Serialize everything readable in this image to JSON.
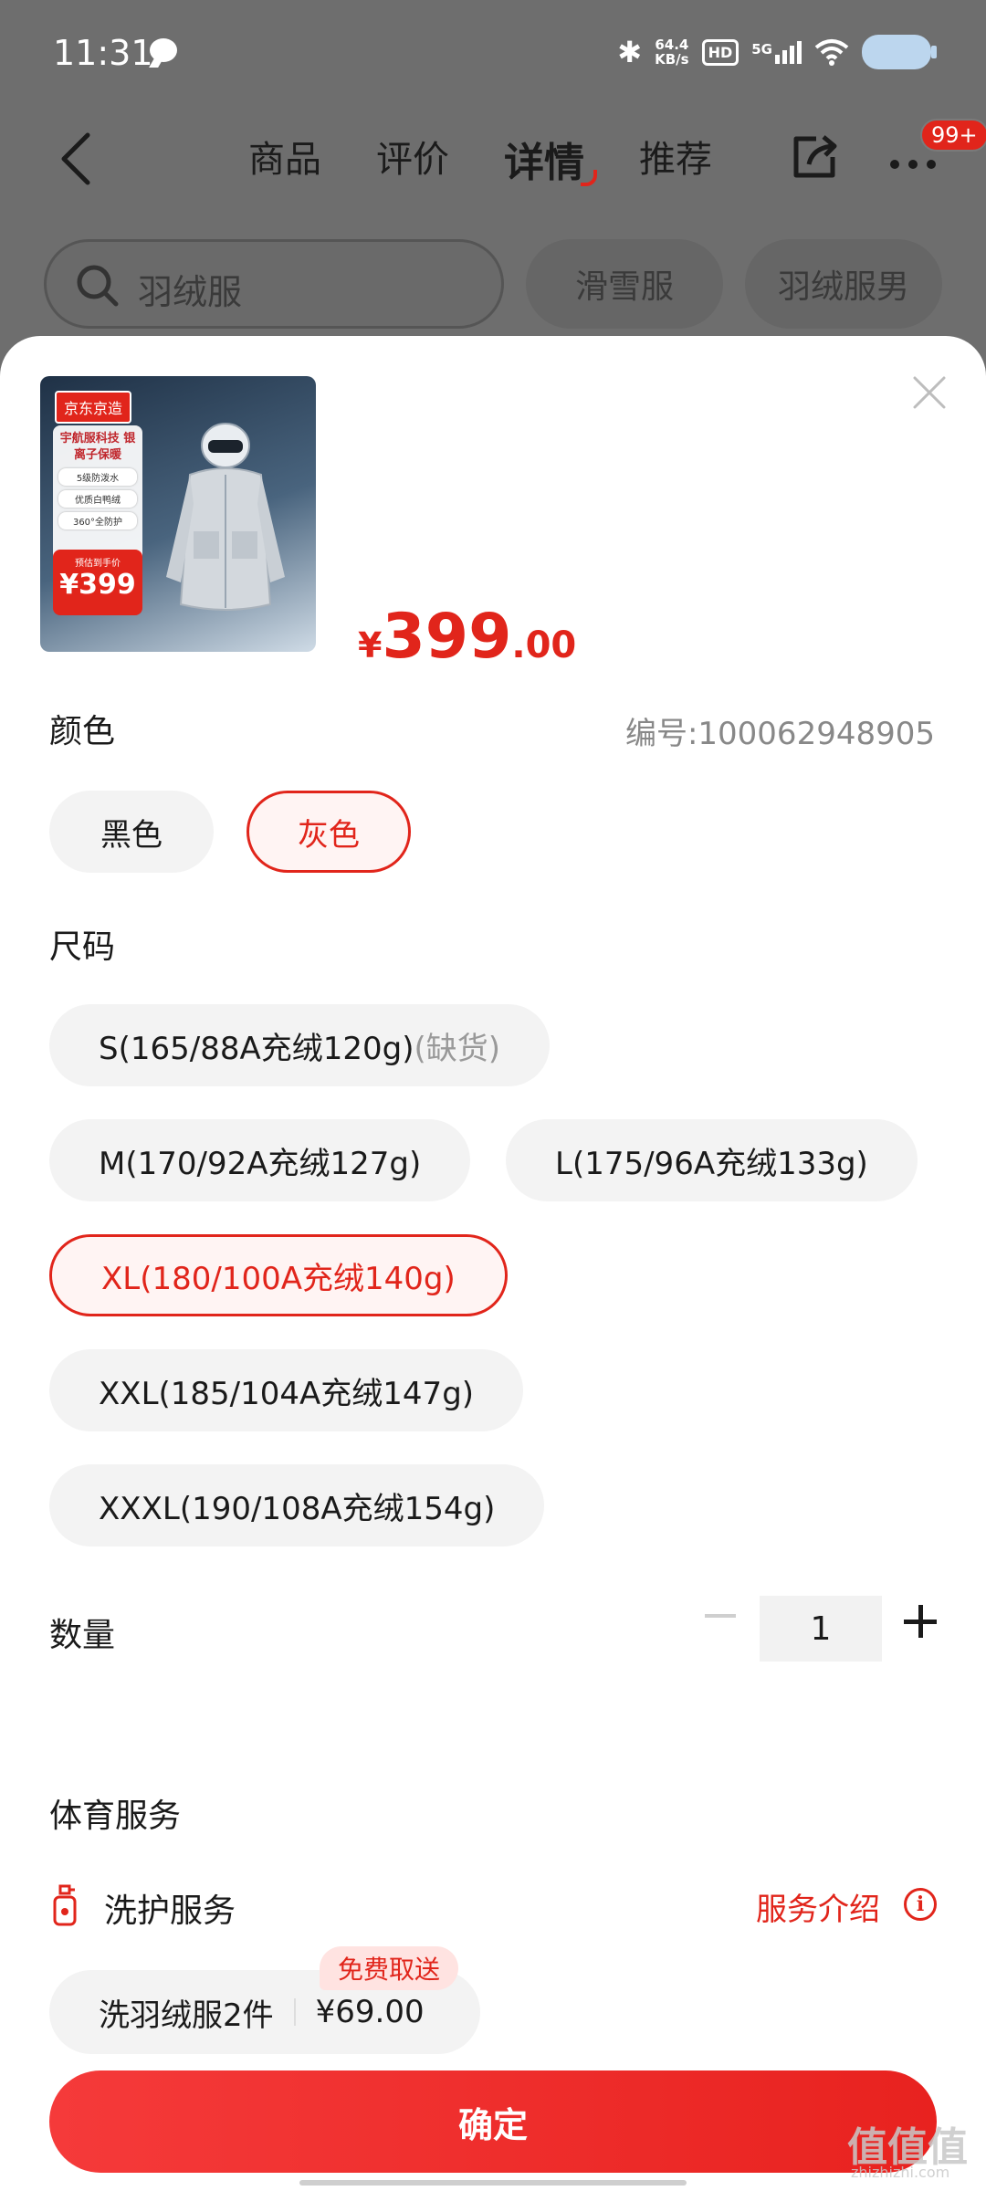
{
  "status_bar": {
    "time": "11:31",
    "net_speed_value": "64.4",
    "net_speed_unit": "KB/s",
    "hd_label": "HD",
    "signal_label": "5G"
  },
  "nav": {
    "tabs": [
      {
        "label": "商品"
      },
      {
        "label": "评价"
      },
      {
        "label": "详情",
        "active": true
      },
      {
        "label": "推荐"
      }
    ],
    "badge": "99+"
  },
  "search": {
    "query": "羽绒服",
    "chips": [
      "滑雪服",
      "羽绒服男"
    ]
  },
  "product": {
    "image": {
      "brand": "京东京造",
      "headline": "宇航服科技 银离子保暖",
      "tags": [
        "5级防泼水",
        "优质白鸭绒",
        "360°全防护"
      ],
      "price_pre": "预估到手价",
      "price": "¥399"
    },
    "price_symbol": "¥",
    "price_int": "399",
    "price_dec": ".00"
  },
  "color_section": {
    "title": "颜色",
    "sku_no": "编号:100062948905",
    "options": [
      {
        "label": "黑色",
        "selected": false
      },
      {
        "label": "灰色",
        "selected": true
      }
    ]
  },
  "size_section": {
    "title": "尺码",
    "options": [
      {
        "label": "S(165/88A充绒120g)",
        "note": "(缺货)",
        "selected": false
      },
      {
        "label": "M(170/92A充绒127g)",
        "selected": false
      },
      {
        "label": "L(175/96A充绒133g)",
        "selected": false
      },
      {
        "label": "XL(180/100A充绒140g)",
        "selected": true
      },
      {
        "label": "XXL(185/104A充绒147g)",
        "selected": false
      },
      {
        "label": "XXXL(190/108A充绒154g)",
        "selected": false
      }
    ]
  },
  "quantity": {
    "title": "数量",
    "value": "1"
  },
  "services": {
    "title": "体育服务",
    "item_name": "洗护服务",
    "intro_label": "服务介绍",
    "card_name": "洗羽绒服2件",
    "card_price": "¥69.00",
    "card_tag": "免费取送"
  },
  "confirm_label": "确定",
  "watermark": "值值值",
  "watermark_sub": "zhizhizhi.com",
  "colors": {
    "accent": "#e1251b",
    "overlay": "#6e6e6e"
  }
}
